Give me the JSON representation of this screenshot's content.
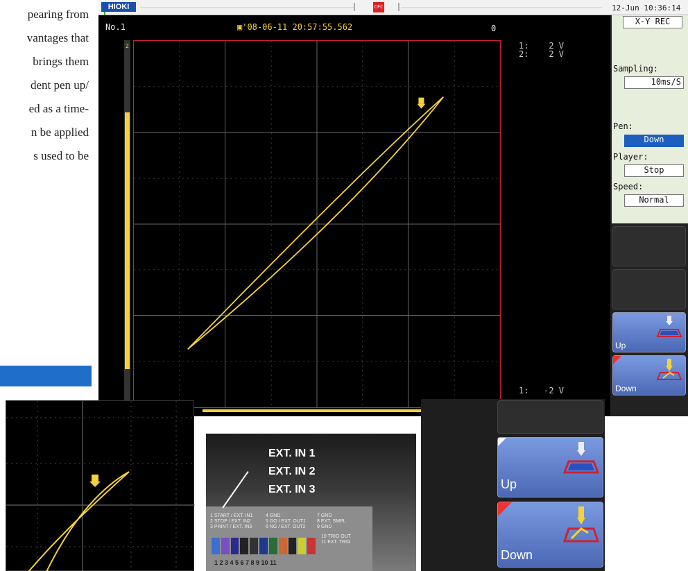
{
  "document": {
    "text_lines": [
      "pearing from",
      "vantages that",
      "brings them",
      "dent pen up/",
      "ed as a time-",
      "n be applied",
      "s used to be"
    ]
  },
  "screen": {
    "brand": "HIOKI",
    "status_icon_label": "CFC",
    "datetime": "12-Jun 10:36:14",
    "channel": "No.1",
    "trigger_time": "'08-06-11 20:57:55.562",
    "zero_value": "0",
    "scale_top": "1:    2 V\n2:    2 V",
    "scale_bottom": "1:   -2 V",
    "y_tick": "2"
  },
  "sidebar": {
    "mode": "X-Y REC",
    "sampling_label": "Sampling:",
    "sampling_value": "10ms/S",
    "pen_label": "Pen:",
    "pen_value": "Down",
    "player_label": "Player:",
    "player_value": "Stop",
    "speed_label": "Speed:",
    "speed_value": "Normal",
    "up_button": "Up",
    "down_button": "Down"
  },
  "connector": {
    "callouts": [
      "EXT. IN 1",
      "EXT. IN 2",
      "EXT. IN 3"
    ],
    "pin_col1": [
      "1 START / EXT. IN1",
      "2 STOP / EXT. IN2",
      "3 PRINT / EXT. IN3"
    ],
    "pin_col2": [
      "4 GND",
      "5 GO / EXT. OUT1",
      "6 NG / EXT. OUT2"
    ],
    "pin_col3": [
      "7 GND",
      "8 EXT. SMPL",
      "9 GND"
    ],
    "pin_col4": [
      "10 TRIG OUT",
      "11 EXT. TRIG"
    ],
    "pin_numbers": "1 2 3 4 5 6 7 8 9 10 11"
  },
  "zoom": {
    "up_button": "Up",
    "down_button": "Down"
  },
  "colors": {
    "trace": "#f5d23a",
    "accent": "#1d5fbf",
    "frame": "#c23"
  }
}
